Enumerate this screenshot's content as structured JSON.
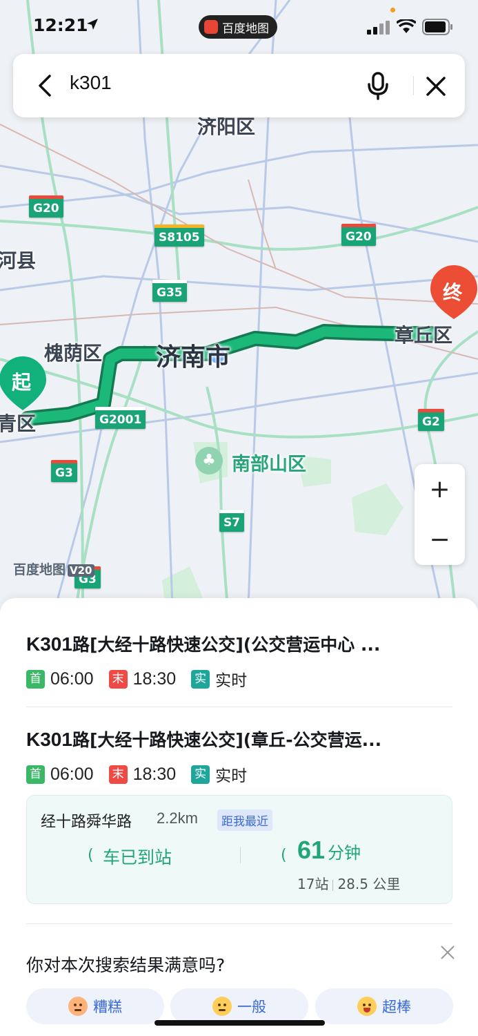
{
  "status_bar": {
    "time": "12:21",
    "app_name": "百度地图"
  },
  "search": {
    "query": "k301"
  },
  "map": {
    "district_labels": [
      "济阳区",
      "河县",
      "槐荫区",
      "济南市",
      "章丘区",
      "青区",
      "南部山区"
    ],
    "road_shields": [
      "G20",
      "S8105",
      "G20",
      "G35",
      "G2001",
      "G2",
      "G3",
      "S7",
      "G3",
      "G20"
    ],
    "start_marker": "起",
    "end_marker": "终",
    "watermark": "百度地图",
    "watermark_version": "V20",
    "zoom_in": "+",
    "zoom_out": "−",
    "route_color": "#1bb87a"
  },
  "routes": [
    {
      "code": "K301",
      "title_rest": "路[大经十路快速公交](公交营运中心 ...",
      "first_tag": "首",
      "first_time": "06:00",
      "last_tag": "末",
      "last_time": "18:30",
      "realtime_tag": "实",
      "realtime_label": "实时"
    },
    {
      "code": "K301",
      "title_rest": "路[大经十路快速公交](章丘-公交营运...",
      "first_tag": "首",
      "first_time": "06:00",
      "last_tag": "末",
      "last_time": "18:30",
      "realtime_tag": "实",
      "realtime_label": "实时"
    }
  ],
  "station": {
    "name": "经十路舜华路",
    "distance": "2.2km",
    "nearest_badge": "距我最近",
    "arrival_status": "车已到站",
    "eta_minutes": "61",
    "eta_unit": "分钟",
    "stops": "17站",
    "route_distance": "28.5 公里"
  },
  "survey": {
    "question": "你对本次搜索结果满意吗?",
    "options": [
      "糟糕",
      "一般",
      "超棒"
    ]
  }
}
